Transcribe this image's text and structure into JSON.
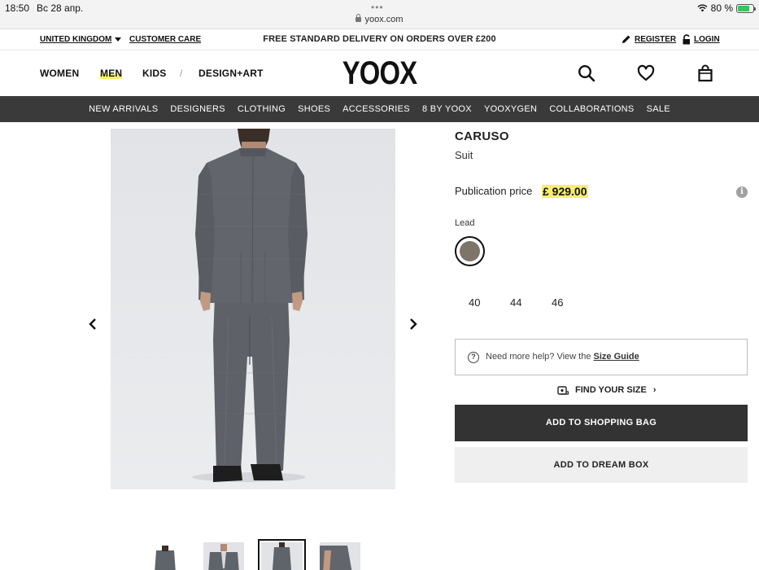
{
  "statusbar": {
    "time": "18:50",
    "date": "Вс 28 апр.",
    "url": "yoox.com",
    "battery": "80 %",
    "battery_level": 0.8
  },
  "utility": {
    "country": "UNITED KINGDOM",
    "customer_care": "CUSTOMER CARE",
    "promo": "FREE STANDARD DELIVERY ON ORDERS OVER £200",
    "register": "REGISTER",
    "login": "LOGIN"
  },
  "header": {
    "nav": [
      "WOMEN",
      "MEN",
      "KIDS",
      "/",
      "DESIGN+ART"
    ],
    "active_nav": "MEN",
    "logo": "YOOX",
    "icons": [
      "search-icon",
      "heart-icon",
      "shopping-bag-icon"
    ]
  },
  "categories": [
    "NEW ARRIVALS",
    "DESIGNERS",
    "CLOTHING",
    "SHOES",
    "ACCESSORIES",
    "8 BY YOOX",
    "YOOXYGEN",
    "COLLABORATIONS",
    "SALE"
  ],
  "product": {
    "brand": "CARUSO",
    "type": "Suit",
    "price_label": "Publication price",
    "price": "£ 929.00",
    "color_label": "Lead",
    "color_hex": "#7d756a",
    "sizes": [
      "40",
      "44",
      "46"
    ],
    "help_text": "Need more help? View the",
    "help_link": "Size Guide",
    "find_size": "FIND YOUR SIZE",
    "add_to_bag": "ADD TO SHOPPING BAG",
    "add_to_dream": "ADD TO DREAM BOX"
  },
  "gallery": {
    "thumbnail_count": 4,
    "active_thumbnail": 3
  },
  "colors": {
    "accent_yellow": "#f6ef6b",
    "dark_bar": "#3a3a3a",
    "primary_button": "#333333"
  }
}
